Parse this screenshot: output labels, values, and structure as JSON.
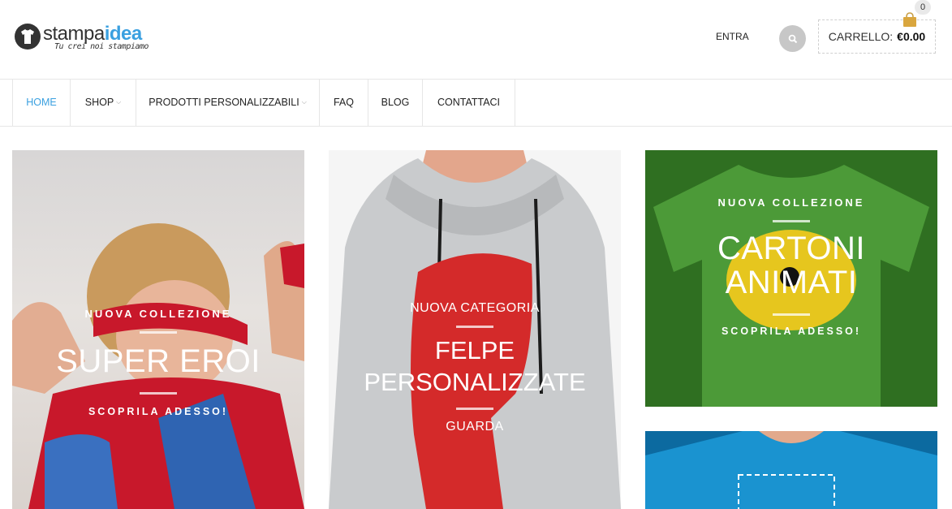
{
  "header": {
    "logo_part1": "stampa",
    "logo_part2": "idea",
    "logo_tagline": "Tu crei noi stampiamo",
    "login_label": "ENTRA",
    "cart_label": "CARRELLO:",
    "cart_amount": "€0.00",
    "cart_count": "0"
  },
  "nav": {
    "items": [
      {
        "label": "HOME"
      },
      {
        "label": "SHOP"
      },
      {
        "label": "PRODOTTI PERSONALIZZABILI"
      },
      {
        "label": "FAQ"
      },
      {
        "label": "BLOG"
      },
      {
        "label": "CONTATTACI"
      }
    ],
    "dropdown_glyph": "⌵"
  },
  "panels": [
    {
      "kicker": "NUOVA COLLEZIONE",
      "title": "SUPER EROI",
      "cta": "SCOPRILA ADESSO!"
    },
    {
      "kicker": "NUOVA CATEGORIA",
      "title_line1": "FELPE",
      "title_line2": "PERSONALIZZATE",
      "cta": "GUARDA"
    },
    {
      "kicker": "NUOVA COLLEZIONE",
      "title_line1": "CARTONI",
      "title_line2": "ANIMATI",
      "cta": "SCOPRILA ADESSO!"
    }
  ],
  "colors": {
    "accent": "#3aa0e0",
    "green_tee": "#3f8e2f",
    "red_print": "#d92b2b",
    "blue_tee": "#1a93d0"
  }
}
